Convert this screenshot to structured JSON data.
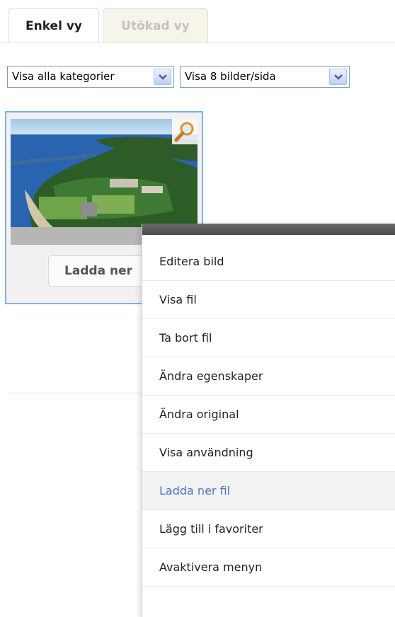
{
  "tabs": [
    {
      "label": "Enkel vy",
      "active": true
    },
    {
      "label": "Utökad vy",
      "active": false
    }
  ],
  "filters": {
    "category": "Visa alla kategorier",
    "per_page": "Visa 8 bilder/sida"
  },
  "card": {
    "download_label": "Ladda ner"
  },
  "context_menu": {
    "items": [
      {
        "label": "Editera bild"
      },
      {
        "label": "Visa fil"
      },
      {
        "label": "Ta bort fil"
      },
      {
        "label": "Ändra egenskaper"
      },
      {
        "label": "Ändra original"
      },
      {
        "label": "Visa användning"
      },
      {
        "label": "Ladda ner fil",
        "highlighted": true
      },
      {
        "label": "Lägg till i favoriter"
      },
      {
        "label": "Avaktivera menyn"
      }
    ]
  },
  "colors": {
    "card_border": "#7cb4de",
    "menu_highlight_text": "#4a73c9",
    "menu_header": "#555555"
  }
}
